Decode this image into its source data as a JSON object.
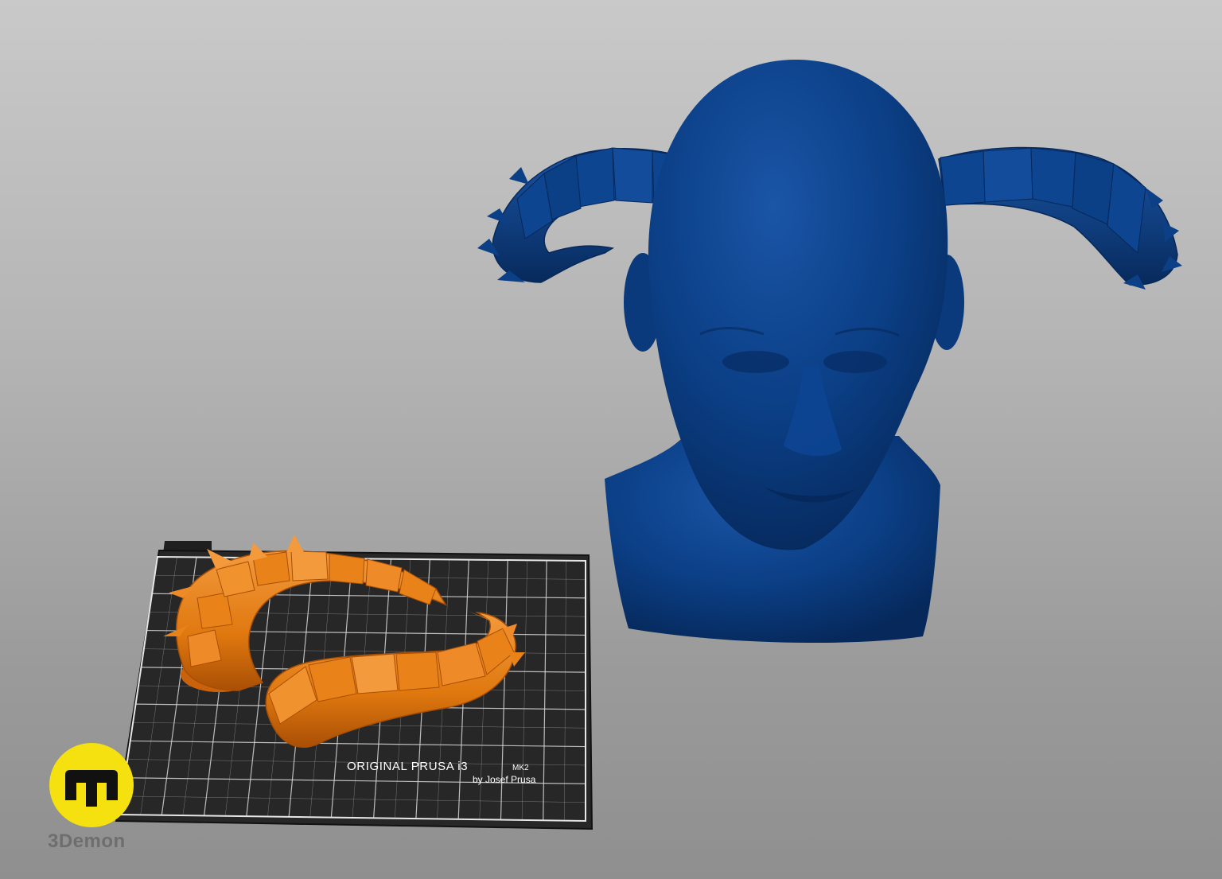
{
  "viewport": {
    "background_top": "#c9c9c9",
    "background_bottom": "#8f8f8f"
  },
  "models": {
    "head": {
      "color": "#0b3f86",
      "shadow_color": "#072a5c",
      "highlight_color": "#1a55a6"
    },
    "horns_on_bed": {
      "color": "#e0780f",
      "shadow_color": "#a94f05",
      "highlight_color": "#f29a3c"
    }
  },
  "print_bed": {
    "title": "ORIGINAL PRUSA i3",
    "model": "MK2",
    "byline": "by Josef Prusa",
    "surface_color": "#2a2a2a",
    "grid_color": "#d8d8d8"
  },
  "watermark": {
    "brand": "3Demon",
    "badge_color": "#f5e10f",
    "icon": "m-logo-icon"
  }
}
